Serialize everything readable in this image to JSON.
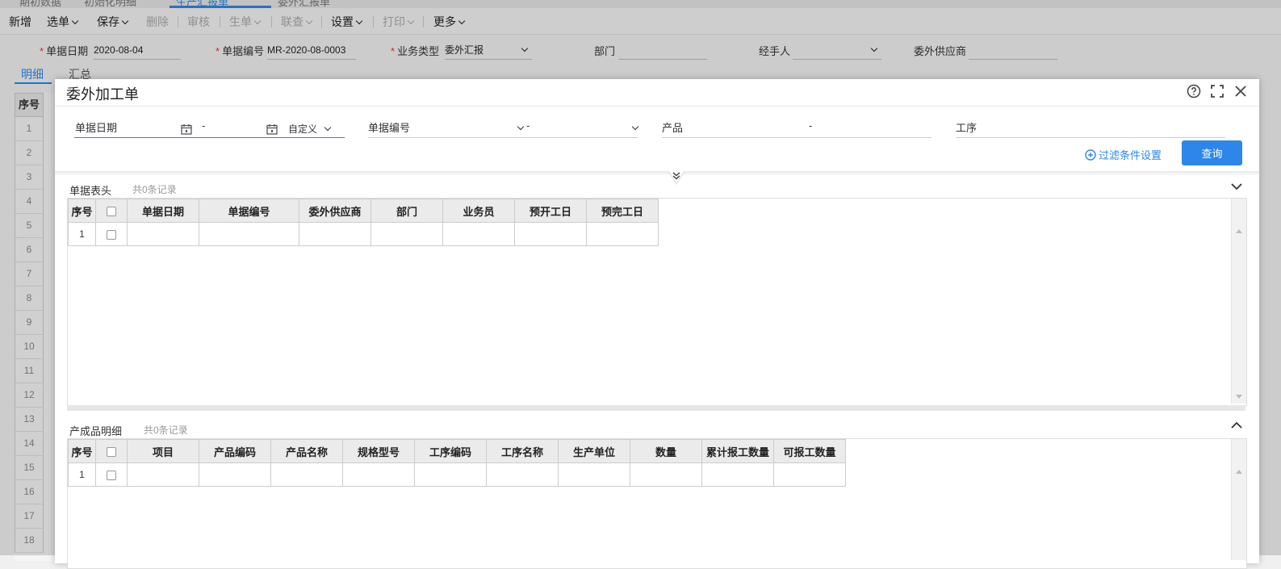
{
  "top_tabs": [
    "期初数据",
    "初始化明细",
    "生产汇报单",
    "委外汇报单"
  ],
  "toolbar": {
    "items": [
      {
        "label": "新增",
        "caret": false,
        "disabled": false
      },
      {
        "label": "选单",
        "caret": true,
        "disabled": false
      },
      {
        "label": "保存",
        "caret": true,
        "disabled": false
      },
      {
        "label": "删除",
        "caret": false,
        "disabled": true
      },
      {
        "label": "审核",
        "caret": false,
        "disabled": true
      },
      {
        "label": "生单",
        "caret": true,
        "disabled": true
      },
      {
        "label": "联查",
        "caret": true,
        "disabled": true
      },
      {
        "label": "设置",
        "caret": true,
        "disabled": false
      },
      {
        "label": "打印",
        "caret": true,
        "disabled": true
      },
      {
        "label": "更多",
        "caret": true,
        "disabled": false
      }
    ]
  },
  "header": {
    "date_label": "单据日期",
    "date_value": "2020-08-04",
    "no_label": "单据编号",
    "no_value": "MR-2020-08-0003",
    "type_label": "业务类型",
    "type_value": "委外汇报",
    "dept_label": "部门",
    "handler_label": "经手人",
    "supplier_label": "委外供应商"
  },
  "body_tabs": [
    "明细",
    "汇总"
  ],
  "bg_grid": {
    "header": "序号",
    "rows": [
      "1",
      "2",
      "3",
      "4",
      "5",
      "6",
      "7",
      "8",
      "9",
      "10",
      "11",
      "12",
      "13",
      "14",
      "15",
      "16",
      "17",
      "18"
    ]
  },
  "modal": {
    "title": "委外加工单",
    "filters": {
      "date_label": "单据日期",
      "dash": "-",
      "range_label": "自定义",
      "no_label": "单据编号",
      "product_label": "产品",
      "process_label": "工序"
    },
    "filter_settings_label": "过滤条件设置",
    "query_label": "查询",
    "head_section": {
      "title": "单据表头",
      "count": "共0条记录",
      "columns": [
        "序号",
        "",
        "单据日期",
        "单据编号",
        "委外供应商",
        "部门",
        "业务员",
        "预开工日",
        "预完工日"
      ],
      "row_no": "1"
    },
    "detail_section": {
      "title": "产成品明细",
      "count": "共0条记录",
      "columns": [
        "序号",
        "",
        "项目",
        "产品编码",
        "产品名称",
        "规格型号",
        "工序编码",
        "工序名称",
        "生产单位",
        "数量",
        "累计报工数量",
        "可报工数量"
      ],
      "row_no": "1"
    }
  }
}
